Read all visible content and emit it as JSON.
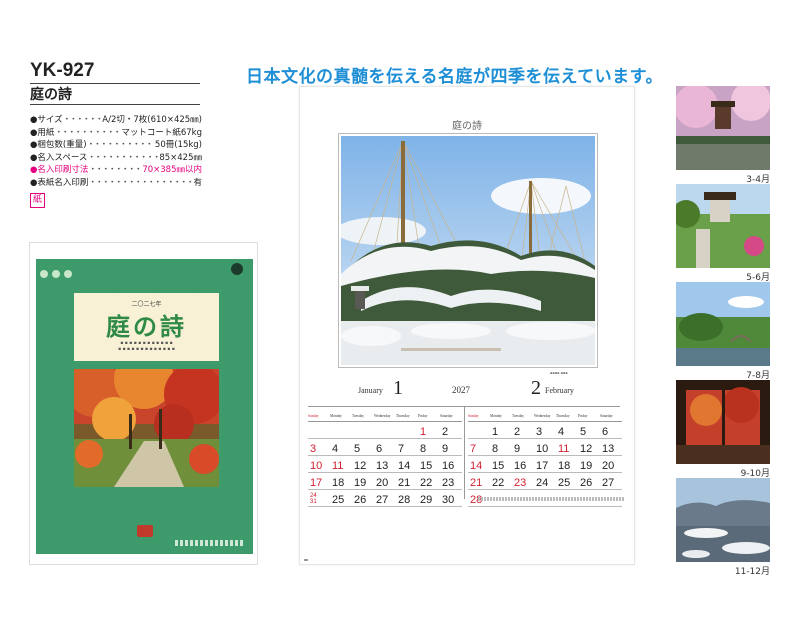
{
  "product": {
    "code": "YK-927",
    "name": "庭の詩"
  },
  "specs": [
    {
      "label": "サイズ",
      "value": "A/2切・7枚(610×425㎜)",
      "highlight": false
    },
    {
      "label": "用紙",
      "value": "マットコート紙67kg",
      "highlight": false
    },
    {
      "label": "梱包数(重量)",
      "value": "50冊(15kg)",
      "highlight": false
    },
    {
      "label": "名入スペース",
      "value": "85×425㎜",
      "highlight": false
    },
    {
      "label": "名入印刷寸法",
      "value": "70×385㎜以内",
      "highlight": true
    },
    {
      "label": "表紙名入印刷",
      "value": "有",
      "highlight": false
    }
  ],
  "paper_badge": "紙",
  "cover": {
    "year": "二〇二七年",
    "title": "庭の詩"
  },
  "headline": "日本文化の真髄を伝える名庭が四季を伝えています。",
  "sheet": {
    "title": "庭の詩",
    "year": "2027",
    "month1": {
      "name": "January",
      "num": "1"
    },
    "month2": {
      "name": "February",
      "num": "2"
    },
    "weekdays": [
      "Sunday",
      "Monday",
      "Tuesday",
      "Wednesday",
      "Thursday",
      "Friday",
      "Saturday"
    ],
    "january": [
      [
        "",
        "",
        "",
        "",
        "",
        "1",
        "2"
      ],
      [
        "3",
        "4",
        "5",
        "6",
        "7",
        "8",
        "9"
      ],
      [
        "10",
        "11",
        "12",
        "13",
        "14",
        "15",
        "16"
      ],
      [
        "17",
        "18",
        "19",
        "20",
        "21",
        "22",
        "23"
      ],
      [
        "24/31",
        "25",
        "26",
        "27",
        "28",
        "29",
        "30"
      ]
    ],
    "february": [
      [
        "",
        "1",
        "2",
        "3",
        "4",
        "5",
        "6"
      ],
      [
        "7",
        "8",
        "9",
        "10",
        "11",
        "12",
        "13"
      ],
      [
        "14",
        "15",
        "16",
        "17",
        "18",
        "19",
        "20"
      ],
      [
        "21",
        "22",
        "23",
        "24",
        "25",
        "26",
        "27"
      ],
      [
        "28",
        "",
        "",
        "",
        "",
        "",
        ""
      ]
    ],
    "holidays_jan": [
      "1",
      "11"
    ],
    "holidays_feb": [
      "11",
      "23"
    ]
  },
  "seasons": [
    {
      "label": "3-4月"
    },
    {
      "label": "5-6月"
    },
    {
      "label": "7-8月"
    },
    {
      "label": "9-10月"
    },
    {
      "label": "11-12月"
    }
  ],
  "colors": {
    "accent_blue": "#1e8fd6",
    "spec_pink": "#e4007f",
    "holiday_red": "#d21f2f",
    "cover_green": "#3d9a6a"
  }
}
